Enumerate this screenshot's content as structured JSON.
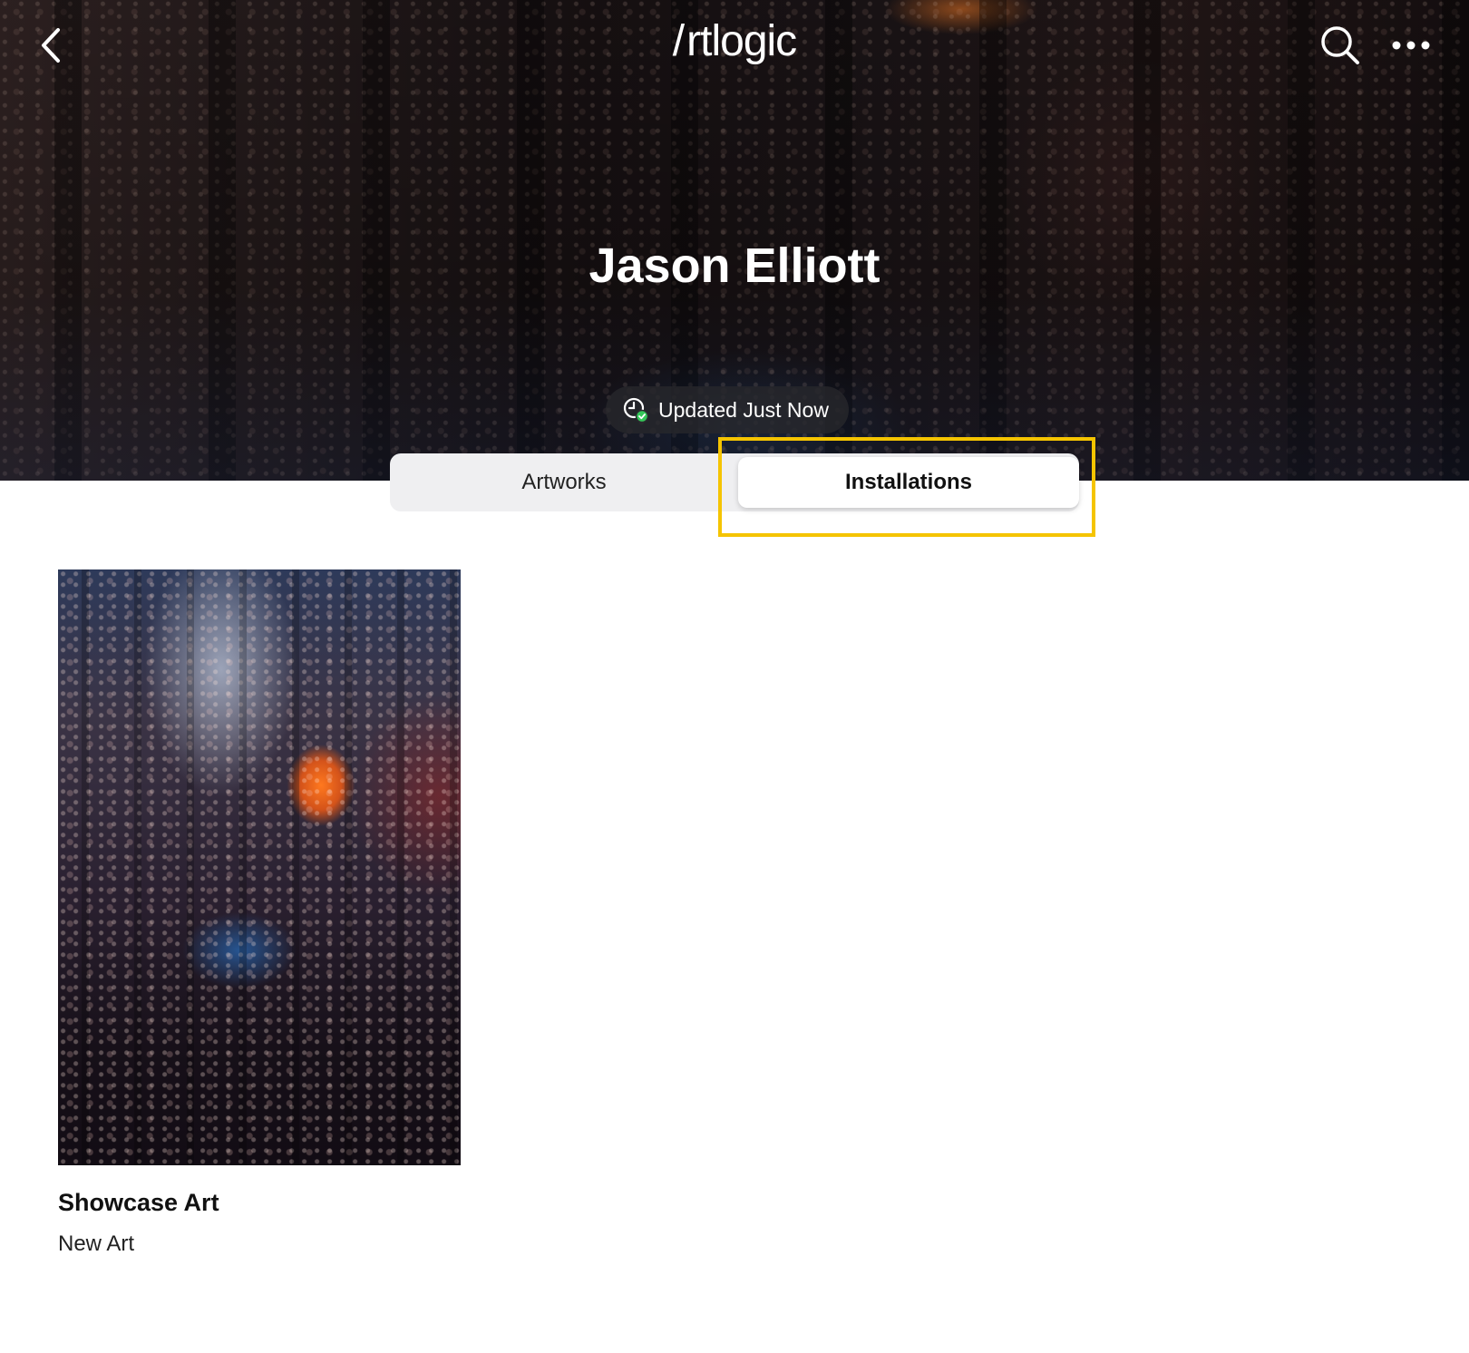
{
  "header": {
    "logo_text": "/ rtlogic",
    "icons": {
      "back": "chevron-left-icon",
      "search": "search-icon",
      "more": "more-horizontal-icon"
    }
  },
  "artist": {
    "name": "Jason Elliott"
  },
  "status": {
    "text": "Updated Just Now",
    "icon": "clock-check-icon",
    "check_color": "#34c759"
  },
  "tabs": [
    {
      "label": "Artworks",
      "selected": false
    },
    {
      "label": "Installations",
      "selected": true
    }
  ],
  "highlight_color": "#f5c400",
  "items": [
    {
      "title": "Showcase Art",
      "subtitle": "New Art"
    }
  ]
}
